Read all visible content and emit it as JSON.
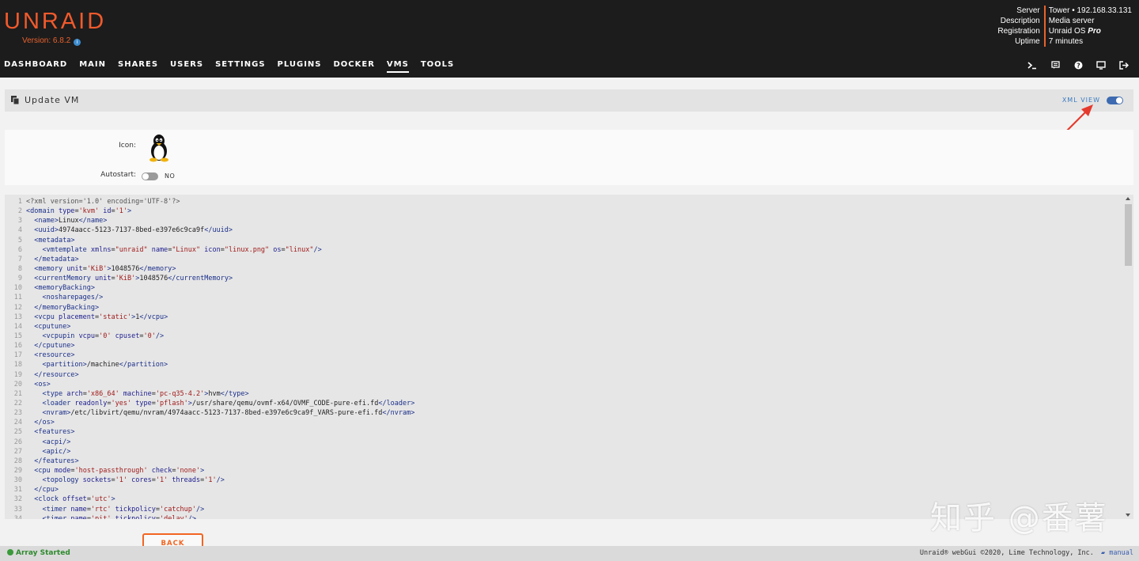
{
  "header": {
    "logo_text": "UNRAID",
    "version": "Version: 6.8.2",
    "server_info": {
      "labels": [
        "Server",
        "Description",
        "Registration",
        "Uptime"
      ],
      "server_value": "Tower • 192.168.33.131",
      "description_value": "Media server",
      "registration_value_prefix": "Unraid OS",
      "registration_value_suffix": "Pro",
      "uptime_value": "7 minutes"
    },
    "nav": [
      "DASHBOARD",
      "MAIN",
      "SHARES",
      "USERS",
      "SETTINGS",
      "PLUGINS",
      "DOCKER",
      "VMS",
      "TOOLS"
    ],
    "active_nav": "VMS",
    "nav_icons": [
      "terminal-icon",
      "feedback-icon",
      "help-icon",
      "monitor-icon",
      "logout-icon"
    ]
  },
  "titlebar": {
    "title": "Update VM",
    "xml_view_label": "XML VIEW",
    "xml_view_on": true
  },
  "form": {
    "icon_label": "Icon:",
    "autostart_label": "Autostart:",
    "autostart_value": "NO"
  },
  "editor": {
    "lines": [
      "<?xml version='1.0' encoding='UTF-8'?>",
      "<domain type='kvm' id='1'>",
      "  <name>Linux</name>",
      "  <uuid>4974aacc-5123-7137-8bed-e397e6c9ca9f</uuid>",
      "  <metadata>",
      "    <vmtemplate xmlns=\"unraid\" name=\"Linux\" icon=\"linux.png\" os=\"linux\"/>",
      "  </metadata>",
      "  <memory unit='KiB'>1048576</memory>",
      "  <currentMemory unit='KiB'>1048576</currentMemory>",
      "  <memoryBacking>",
      "    <nosharepages/>",
      "  </memoryBacking>",
      "  <vcpu placement='static'>1</vcpu>",
      "  <cputune>",
      "    <vcpupin vcpu='0' cpuset='0'/>",
      "  </cputune>",
      "  <resource>",
      "    <partition>/machine</partition>",
      "  </resource>",
      "  <os>",
      "    <type arch='x86_64' machine='pc-q35-4.2'>hvm</type>",
      "    <loader readonly='yes' type='pflash'>/usr/share/qemu/ovmf-x64/OVMF_CODE-pure-efi.fd</loader>",
      "    <nvram>/etc/libvirt/qemu/nvram/4974aacc-5123-7137-8bed-e397e6c9ca9f_VARS-pure-efi.fd</nvram>",
      "  </os>",
      "  <features>",
      "    <acpi/>",
      "    <apic/>",
      "  </features>",
      "  <cpu mode='host-passthrough' check='none'>",
      "    <topology sockets='1' cores='1' threads='1'/>",
      "  </cpu>",
      "  <clock offset='utc'>",
      "    <timer name='rtc' tickpolicy='catchup'/>",
      "    <timer name='pit' tickpolicy='delay'/>"
    ]
  },
  "buttons": {
    "back": "BACK"
  },
  "footer": {
    "status": "Array Started",
    "copyright": "Unraid® webGui ©2020, Lime Technology, Inc.",
    "manual": "manual"
  },
  "watermark": "知乎 @番薯",
  "colors": {
    "brand_orange": "#f15a2c",
    "header_bg": "#1c1c1c",
    "accent_blue": "#3d6ab0",
    "status_green": "#2f8a2f",
    "annotation_red": "#e53a2e"
  }
}
